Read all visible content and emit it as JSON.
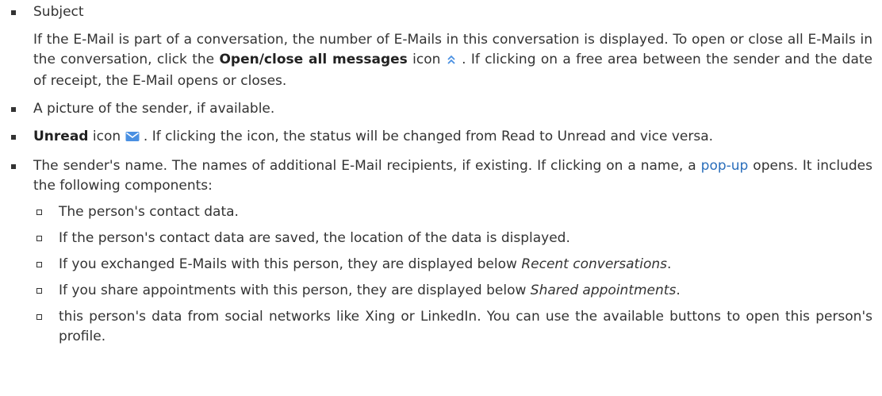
{
  "items": [
    {
      "label": "Subject",
      "para_text1": "If the E-Mail is part of a conversation, the number of E-Mails in this conversation is displayed. To open or close all E-Mails in the conversation, click the ",
      "para_bold": "Open/close all messages",
      "para_text2": " icon ",
      "para_text3": " . If clicking on a free area between the sender and the date of receipt, the E-Mail opens or closes.",
      "icon": "double-chevron-up-icon"
    },
    {
      "text": "A picture of the sender, if available."
    },
    {
      "bold": "Unread",
      "text1": " icon ",
      "text2": " . If clicking the icon, the status will be changed from Read to Unread and vice versa.",
      "icon": "envelope-icon"
    },
    {
      "text1": "The sender's name. The names of additional E-Mail recipients, if existing. If clicking on a name, a ",
      "link": "pop-up",
      "text2": " opens. It includes the following components:",
      "subitems": [
        {
          "text": "The person's contact data."
        },
        {
          "text": "If the person's contact data are saved, the location of the data is displayed."
        },
        {
          "text1": "If you exchanged E-Mails with this person, they are displayed below ",
          "italic": "Recent conversations",
          "text2": "."
        },
        {
          "text1": "If you share appointments with this person, they are displayed below ",
          "italic": "Shared appointments",
          "text2": "."
        },
        {
          "text": "this person's data from social networks like Xing or LinkedIn. You can use the available buttons to open this person's profile."
        }
      ]
    }
  ],
  "colors": {
    "text": "#333333",
    "link": "#2a6ebb",
    "icon": "#4a90e2"
  }
}
